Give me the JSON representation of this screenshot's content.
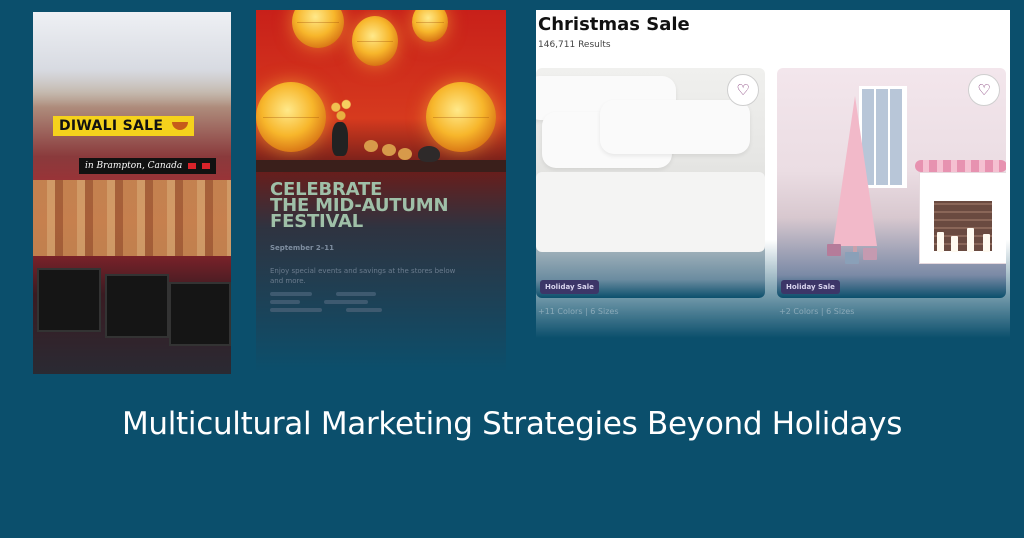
{
  "diwali": {
    "tag": "DIWALI SALE",
    "subtag": "in Brampton, Canada"
  },
  "mid_autumn": {
    "headline_line1": "CELEBRATE",
    "headline_line2": "THE MID-AUTUMN",
    "headline_line3": "FESTIVAL",
    "dates": "September 2–11",
    "body": "Enjoy special events and savings at the stores below and more."
  },
  "christmas": {
    "title": "Christmas Sale",
    "results": "146,711 Results",
    "products": [
      {
        "badge": "Holiday Sale",
        "variants": "+11 Colors | 6 Sizes"
      },
      {
        "badge": "Holiday Sale",
        "variants": "+2 Colors | 6 Sizes"
      }
    ]
  },
  "headline": "Multicultural Marketing Strategies Beyond Holidays",
  "colors": {
    "background": "#0b4f6c",
    "diwali_tag": "#f5d21c",
    "badge": "#3c3668",
    "heart": "#7a2c6e"
  },
  "icons": [
    "heart-icon",
    "flag-icon",
    "diya-icon"
  ]
}
